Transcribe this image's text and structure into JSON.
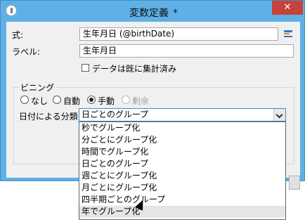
{
  "window": {
    "title": "変数定義",
    "title_modified_marker": "*",
    "close_glyph": "✕"
  },
  "form": {
    "expression_label": "式:",
    "expression_value": "生年月日 (@birthDate)",
    "label_label": "ラベル:",
    "label_value": "生年月日",
    "already_aggregated_label": "データは既に集計済み",
    "already_aggregated_checked": false
  },
  "binning": {
    "group_title": "ビニング",
    "options": [
      {
        "label": "なし",
        "selected": false,
        "enabled": true
      },
      {
        "label": "自動",
        "selected": false,
        "enabled": true
      },
      {
        "label": "手動",
        "selected": true,
        "enabled": true
      },
      {
        "label": "剰余",
        "selected": false,
        "enabled": false
      }
    ],
    "date_classification_label": "日付による分類:",
    "date_classification_value": "日ごとのグループ",
    "date_classification_options": [
      "秒でグループ化",
      "分ごとにグループ化",
      "時間でグループ化",
      "日ごとのグループ",
      "週ごとにグループ化",
      "月ごとにグループ化",
      "四半期ごとのグループ",
      "年でグループ化"
    ],
    "hovered_option_index": 7
  }
}
